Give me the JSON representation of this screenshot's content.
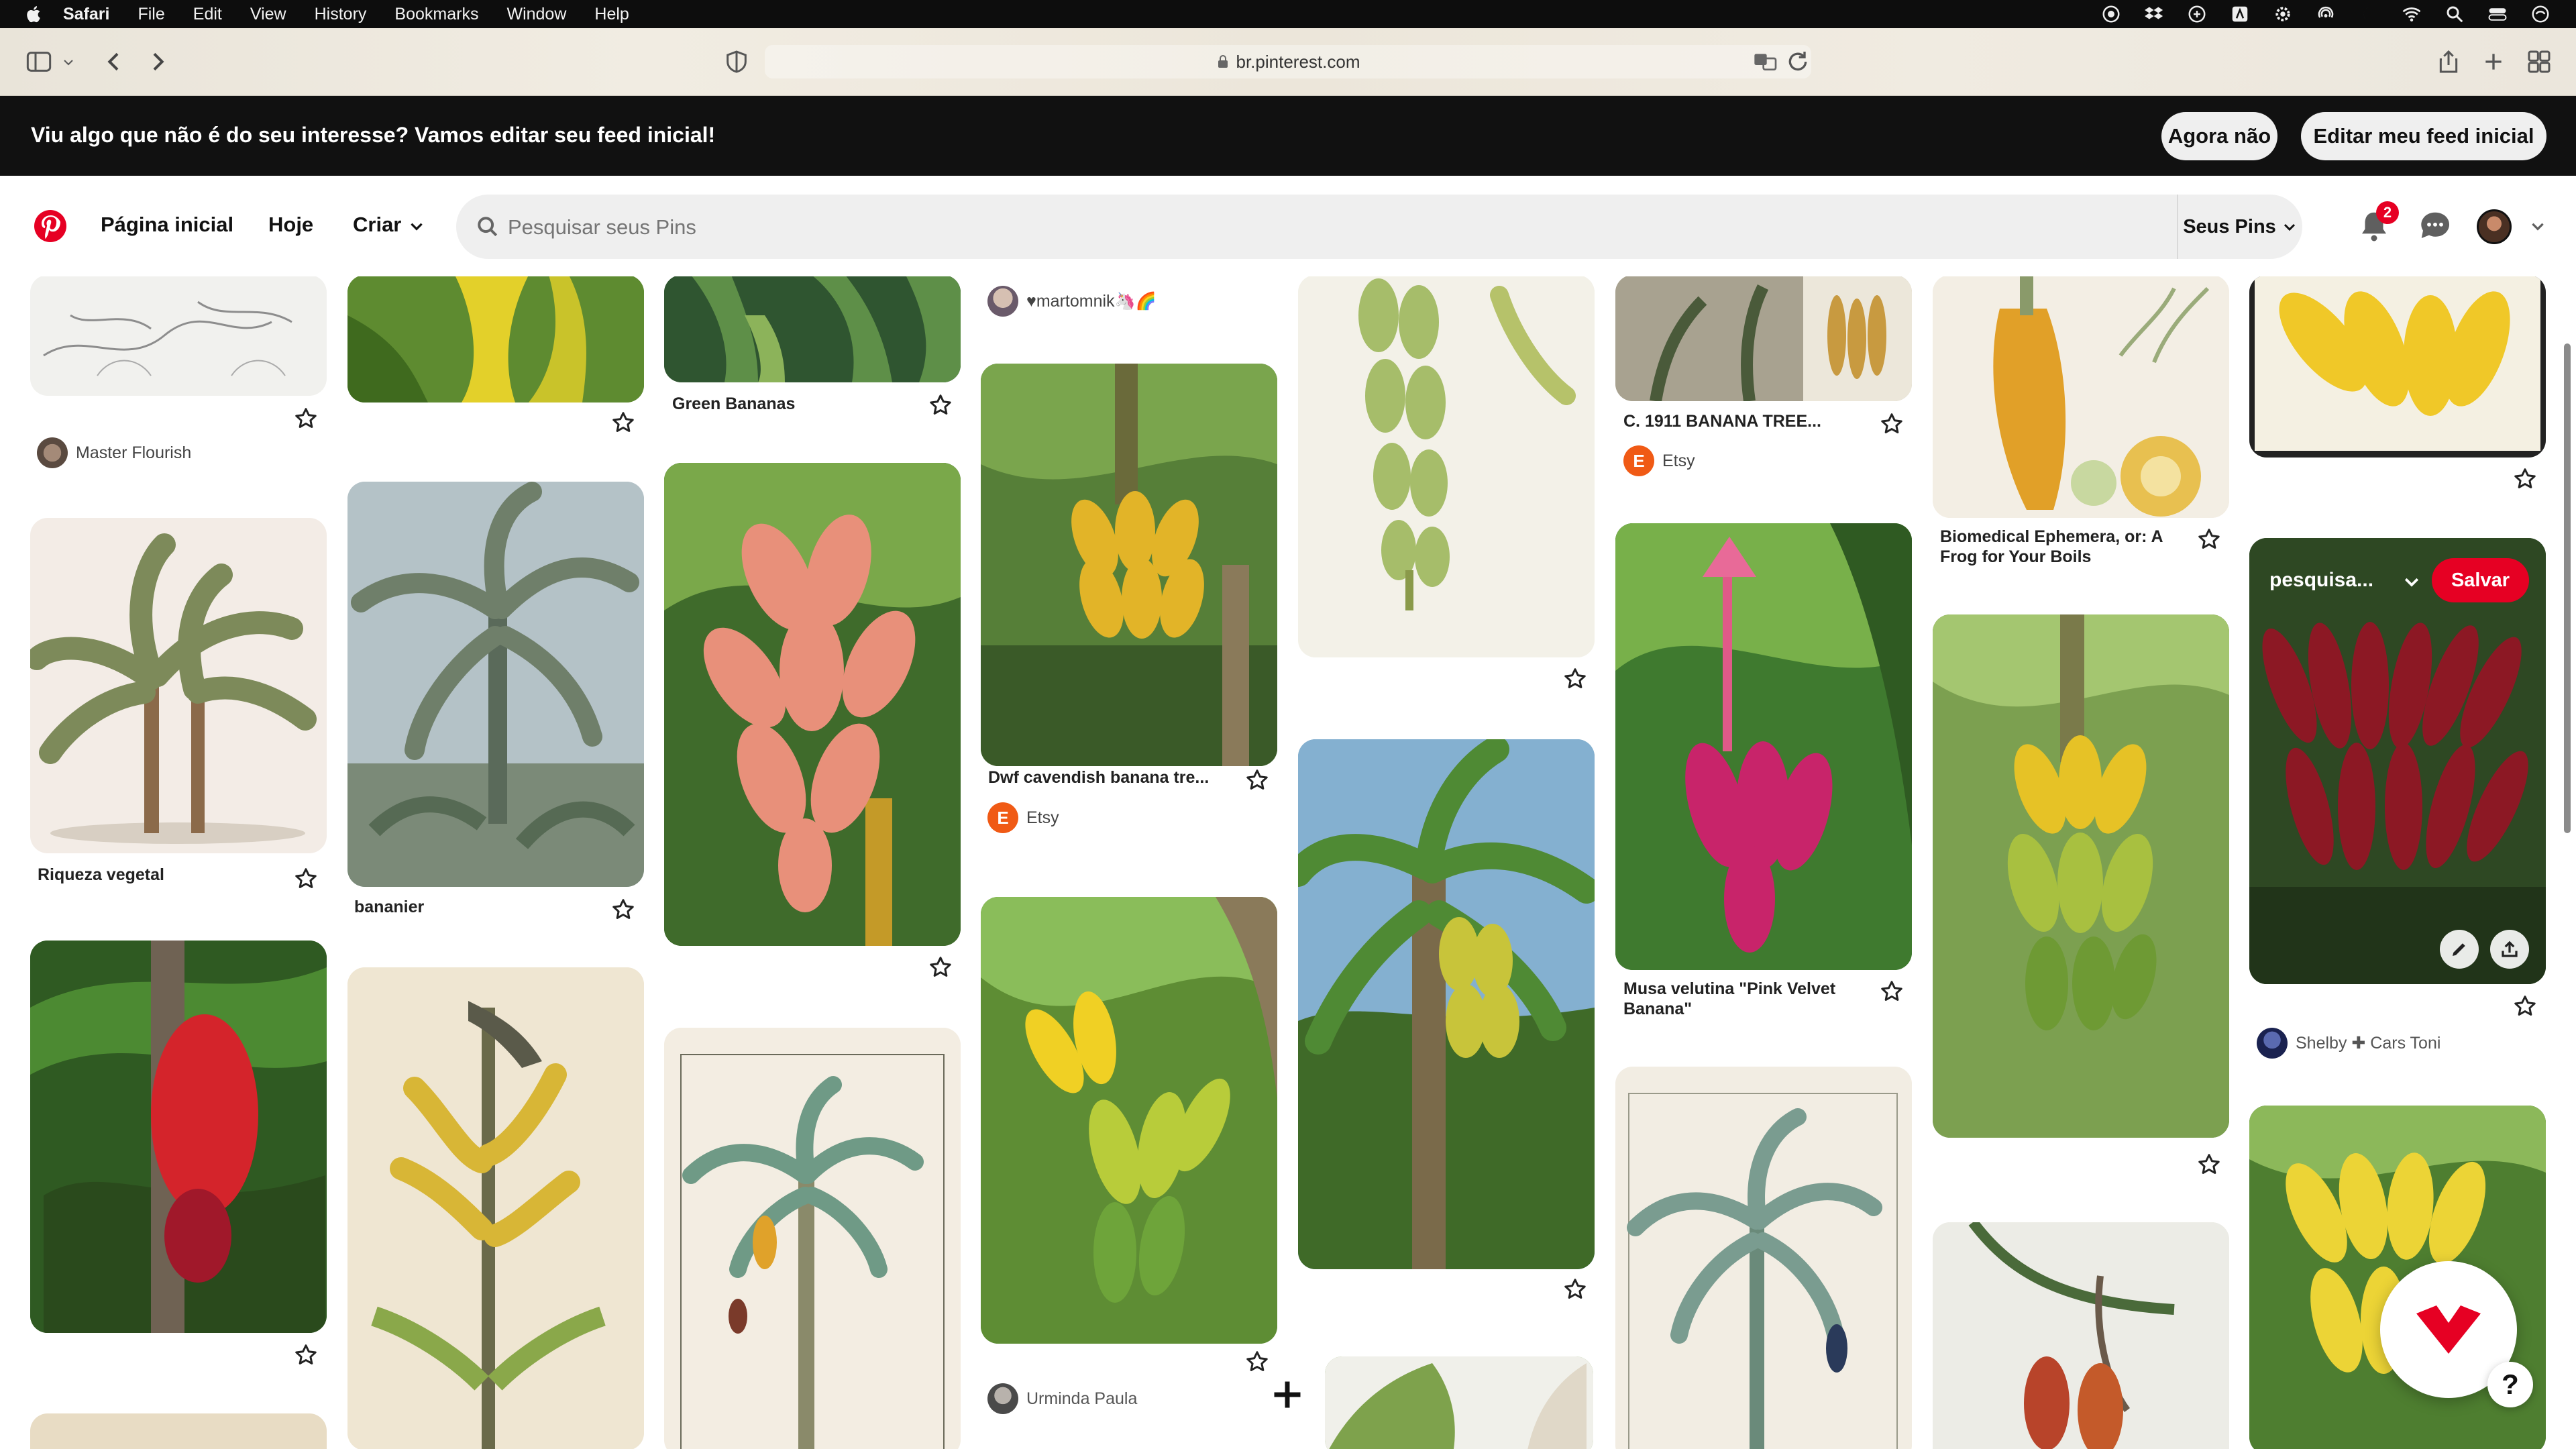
{
  "menubar": {
    "app": "Safari",
    "items": [
      "File",
      "Edit",
      "View",
      "History",
      "Bookmarks",
      "Window",
      "Help"
    ]
  },
  "browser": {
    "url": "br.pinterest.com"
  },
  "banner": {
    "message": "Viu algo que não é do seu interesse? Vamos editar seu feed inicial!",
    "dismiss_label": "Agora não",
    "edit_label": "Editar meu feed inicial"
  },
  "header": {
    "nav": {
      "home": "Página inicial",
      "today": "Hoje",
      "create": "Criar"
    },
    "search_placeholder": "Pesquisar seus Pins",
    "your_pins": "Seus Pins",
    "notification_count": "2",
    "accent_color": "#e60023"
  },
  "pins": {
    "master_flourish_author": "Master Flourish",
    "green_bananas_title": "Green Bananas",
    "martomnik_author": "♥martomnik🦄🌈",
    "banana_tree_title": "C. 1911 BANANA TREE...",
    "banana_tree_source": "Etsy",
    "biomedical_title_l1": "Biomedical Ephemera, or: A",
    "biomedical_title_l2": "Frog for Your Boils",
    "riqueza_title": "Riqueza vegetal",
    "bananier_title": "bananier",
    "cavendish_title": "Dwf cavendish banana tre...",
    "cavendish_source": "Etsy",
    "pink_velvet_title_l1": "Musa velutina \"Pink Velvet",
    "pink_velvet_title_l2": "Banana\"",
    "hover_board": "pesquisa...",
    "save_label": "Salvar",
    "shelby_author": "Shelby ✚ Cars Toni",
    "urminda_author": "Urminda Paula"
  },
  "help_label": "?"
}
